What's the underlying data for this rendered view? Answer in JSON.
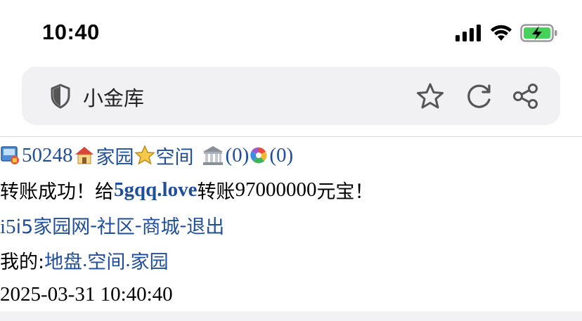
{
  "status": {
    "time": "10:40"
  },
  "address_bar": {
    "title": "小金库"
  },
  "nav": {
    "user_id": "50248",
    "home_label": "家园",
    "space_label": "空间",
    "bank_count": "(0)",
    "msg_count": "(0)"
  },
  "message": {
    "prefix": "转账成功！给",
    "recipient": "5gqq.love",
    "middle": "转账",
    "amount": "97000000",
    "suffix": "元宝！"
  },
  "links": {
    "site": "i5家园网",
    "sep1": "-",
    "community": "社区",
    "sep2": "-",
    "mall": "商城",
    "sep3": "-",
    "logout": "退出"
  },
  "mine": {
    "label": "我的:",
    "land": "地盘",
    "dot1": ".",
    "space": "空间",
    "dot2": ".",
    "home": "家园"
  },
  "timestamp": "2025-03-31 10:40:40"
}
